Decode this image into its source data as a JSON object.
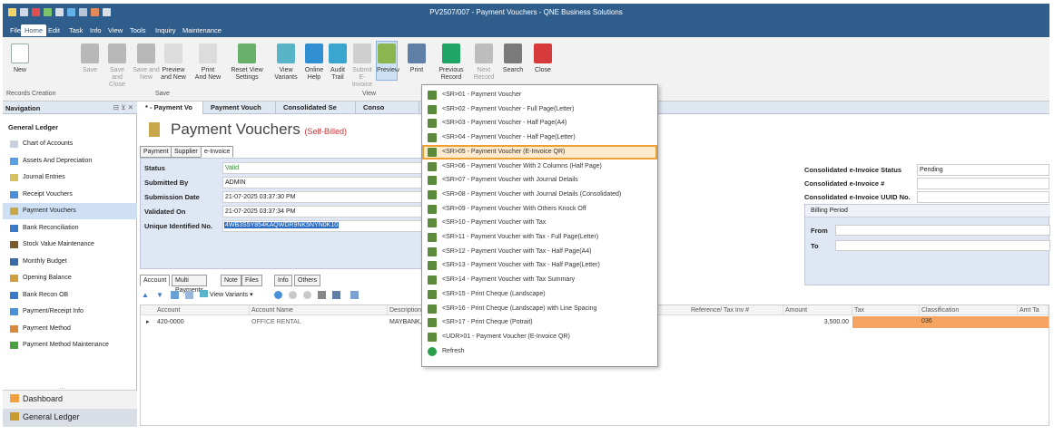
{
  "window": {
    "title": "PV2507/007 - Payment Vouchers - QNE Business Solutions"
  },
  "menu": [
    "File",
    "Home",
    "Edit",
    "Task",
    "Info",
    "View",
    "Tools",
    "Inquiry",
    "Maintenance"
  ],
  "ribbon": {
    "buttons": [
      {
        "label": "New",
        "sub": "",
        "color": "#ffffff",
        "gray": false
      },
      {
        "label": "Save",
        "sub": "",
        "color": "#b8b8b8",
        "gray": true
      },
      {
        "label": "Save and",
        "sub": "Close",
        "color": "#b8b8b8",
        "gray": true
      },
      {
        "label": "Save and New",
        "sub": "",
        "color": "#b8b8b8",
        "gray": true
      },
      {
        "label": "Preview",
        "sub": "and New",
        "color": "#dcdcdc",
        "gray": false
      },
      {
        "label": "Print",
        "sub": "And New",
        "color": "#dcdcdc",
        "gray": false
      },
      {
        "label": "Reset View",
        "sub": "Settings",
        "color": "#69b06a",
        "gray": false
      },
      {
        "label": "View Variants",
        "sub": "",
        "color": "#5ab4c8",
        "gray": false
      },
      {
        "label": "Online",
        "sub": "Help",
        "color": "#2f8fd0",
        "gray": false
      },
      {
        "label": "Audit",
        "sub": "Trail",
        "color": "#3aa6d0",
        "gray": false
      },
      {
        "label": "Submit",
        "sub": "E-Invoice",
        "color": "#cfcfcf",
        "gray": true
      },
      {
        "label": "Preview",
        "sub": "",
        "color": "#8ab54f",
        "gray": false
      },
      {
        "label": "Print",
        "sub": "",
        "color": "#5f7fa6",
        "gray": false
      },
      {
        "label": "Previous",
        "sub": "Record",
        "color": "#1fa566",
        "gray": false
      },
      {
        "label": "Next Record",
        "sub": "",
        "color": "#bdbdbd",
        "gray": true
      },
      {
        "label": "Search",
        "sub": "",
        "color": "#7a7a7a",
        "gray": false
      },
      {
        "label": "Close",
        "sub": "",
        "color": "#d63a3a",
        "gray": false
      }
    ],
    "groups": [
      "Records Creation",
      "Save",
      "View"
    ]
  },
  "navigation": {
    "header": "Navigation",
    "section": "General Ledger",
    "items": [
      "Chart of Accounts",
      "Assets And Depreciation",
      "Journal Entries",
      "Receipt Vouchers",
      "Payment Vouchers",
      "Bank Reconciliation",
      "Stock Value Maintenance",
      "Monthly Budget",
      "Opening Balance",
      "Bank Recon OB",
      "Payment/Receipt Info",
      "Payment Method",
      "Payment Method Maintenance"
    ],
    "selected": "Payment Vouchers",
    "bottom": [
      "Dashboard",
      "General Ledger"
    ],
    "more": "..."
  },
  "doc_tabs": [
    "* - Payment Vo",
    "Payment Vouch",
    "Consolidated Se",
    "Conso"
  ],
  "page": {
    "title": "Payment Vouchers",
    "badge": "(Self-Billed)"
  },
  "subtabs": [
    "Payment",
    "Supplier",
    "e-Invoice"
  ],
  "einvoice": {
    "fields": [
      {
        "label": "Status",
        "value": "Valid"
      },
      {
        "label": "Submitted By",
        "value": "ADMIN"
      },
      {
        "label": "Submission Date",
        "value": "21-07-2025 03:37:30 PM"
      },
      {
        "label": "Validated On",
        "value": "21-07-2025 03:37:34 PM"
      },
      {
        "label": "Unique Identified No.",
        "value": "4WB3S5Y854KAQWDR9NK5NYN0K10"
      }
    ]
  },
  "right_panel": {
    "fields": [
      {
        "label": "Consolidated e-Invoice Status",
        "value": "Pending"
      },
      {
        "label": "Consolidated e-Invoice #",
        "value": ""
      },
      {
        "label": "Consolidated e-Invoice UUID No.",
        "value": ""
      }
    ],
    "billing": {
      "title": "Billing Period",
      "from": "From",
      "to": "To"
    }
  },
  "grid_tabs": [
    "Account",
    "Multi Payments",
    "Note",
    "Files",
    "Info",
    "Others"
  ],
  "grid_toolbar": {
    "view_variants": "View Variants"
  },
  "grid": {
    "columns": [
      "Account",
      "Account Name",
      "Description",
      "Reference/ Tax Inv #",
      "Amount",
      "Tax",
      "Classification",
      "Amt Ta"
    ],
    "rows": [
      {
        "account": "420-0000",
        "name": "OFFICE RENTAL",
        "description": "MAYBANK,",
        "reference": "",
        "amount": "3,500.00",
        "tax": "",
        "classification": "036"
      }
    ]
  },
  "preview_menu": {
    "items": [
      "<SR>01 - Payment Voucher",
      "<SR>02 - Payment Voucher - Full Page(Letter)",
      "<SR>03 - Payment Voucher - Half Page(A4)",
      "<SR>04 - Payment Voucher - Half Page(Letter)",
      "<SR>05 - Payment Voucher (E-Invoice QR)",
      "<SR>06 - Payment Voucher With 2 Columns (Half Page)",
      "<SR>07 - Payment Voucher with Journal Details",
      "<SR>08 - Payment Voucher with Journal Details (Consolidated)",
      "<SR>09 - Payment Voucher With Others Knock Off",
      "<SR>10 - Payment Voucher with Tax",
      "<SR>11 - Payment Voucher with Tax - Full Page(Letter)",
      "<SR>12 - Payment Voucher with Tax - Half Page(A4)",
      "<SR>13 - Payment Voucher with Tax - Half Page(Letter)",
      "<SR>14 - Payment Voucher with Tax Summary",
      "<SR>15 - Print Cheque (Landscape)",
      "<SR>16 - Print Cheque (Landscape) with Line Spacing",
      "<SR>17 - Print Cheque (Potrait)",
      "<UDR>01 - Payment Voucher (E-Invoice QR)",
      "Refresh"
    ],
    "highlighted_index": 4
  },
  "colors": {
    "titlebar": "#2f5e8c",
    "accent": "#f0a030",
    "selected": "#cfe0f5"
  }
}
